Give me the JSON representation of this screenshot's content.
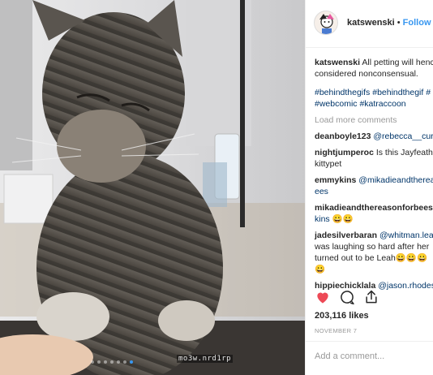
{
  "post": {
    "media": {
      "watermark": "mo3w.nrd1rp",
      "carousel_count": 7,
      "carousel_active": 6
    },
    "header": {
      "username": "katswenski",
      "separator": " • ",
      "follow_label": "Follow"
    },
    "caption": {
      "username": "katswenski",
      "text_line1": "All petting will hence",
      "text_line2": "considered nonconsensual.",
      "tags_line1": "#behindthegifs #behindthegif #",
      "tags_line2": "#webcomic #katraccoon"
    },
    "load_more": "Load more comments",
    "comments": [
      {
        "user": "deanboyle123",
        "lines": [
          "@rebecca__curry"
        ]
      },
      {
        "user": "nightjumperoc",
        "lines": [
          "Is this Jayfeathe",
          "kittypet"
        ]
      },
      {
        "user": "emmykins",
        "lines": [
          "@mikadieandtherea",
          "ees"
        ]
      },
      {
        "user": "mikadieandthereasonforbees",
        "lines": [
          "😀",
          "kins 😀😀"
        ]
      },
      {
        "user": "jadesilverbaran",
        "lines": [
          "@whitman.leah",
          "was laughing so hard after her",
          "turned out to be Leah😀😀😀",
          "😀"
        ]
      },
      {
        "user": "hippiechicklala",
        "lines": [
          "@jason.rhodes"
        ]
      }
    ],
    "likes": "203,116 likes",
    "date": "NOVEMBER 7",
    "add_comment_placeholder": "Add a comment..."
  },
  "icons": [
    "heart-icon",
    "comment-icon",
    "share-icon"
  ],
  "colors": {
    "like_red": "#ed4956",
    "link_blue": "#3897f0",
    "hashtag_navy": "#003569",
    "muted_gray": "#999999"
  }
}
